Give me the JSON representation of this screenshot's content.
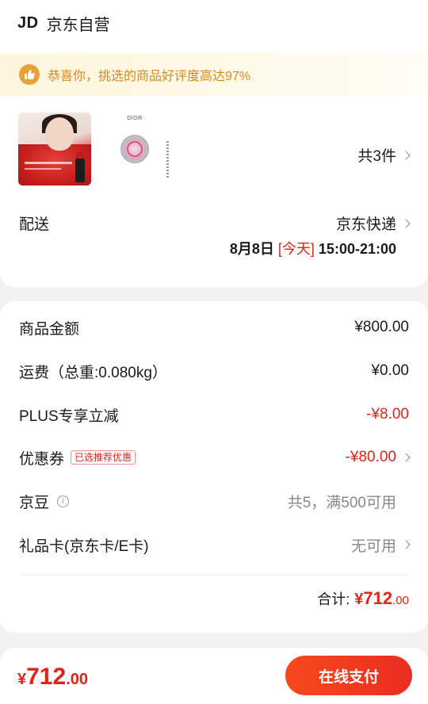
{
  "shop": {
    "prefix": "JD",
    "name": "京东自营"
  },
  "notice": {
    "text": "恭喜你，挑选的商品好评度高达97%",
    "icon": "thumbs-up-icon"
  },
  "products": {
    "thumb1_desc": "dior-lipstick-product-image",
    "thumb2_brand": "DIOR",
    "count_text": "共3件"
  },
  "shipping": {
    "label": "配送",
    "method": "京东快递",
    "date": "8月8日",
    "today": "[今天]",
    "time": "15:00-21:00"
  },
  "costs": {
    "goods": {
      "label": "商品金额",
      "value": "¥800.00"
    },
    "freight": {
      "label": "运费（总重:0.080kg）",
      "value": "¥0.00"
    },
    "plus": {
      "label": "PLUS专享立减",
      "value": "-¥8.00"
    },
    "coupon": {
      "label": "优惠券",
      "tag": "已选推荐优惠",
      "value": "-¥80.00"
    },
    "beans": {
      "label": "京豆",
      "value": "共5，满500可用"
    },
    "giftcard": {
      "label": "礼品卡(京东卡/E卡)",
      "value": "无可用"
    }
  },
  "total": {
    "label": "合计:",
    "currency": "¥",
    "int": "712",
    "dec": ".00"
  },
  "footer": {
    "currency": "¥",
    "int": "712",
    "dec": ".00",
    "pay_label": "在线支付"
  },
  "colors": {
    "accent": "#e2231a",
    "notice_text": "#d98a1e",
    "notice_bg": "#fdf6dc"
  }
}
